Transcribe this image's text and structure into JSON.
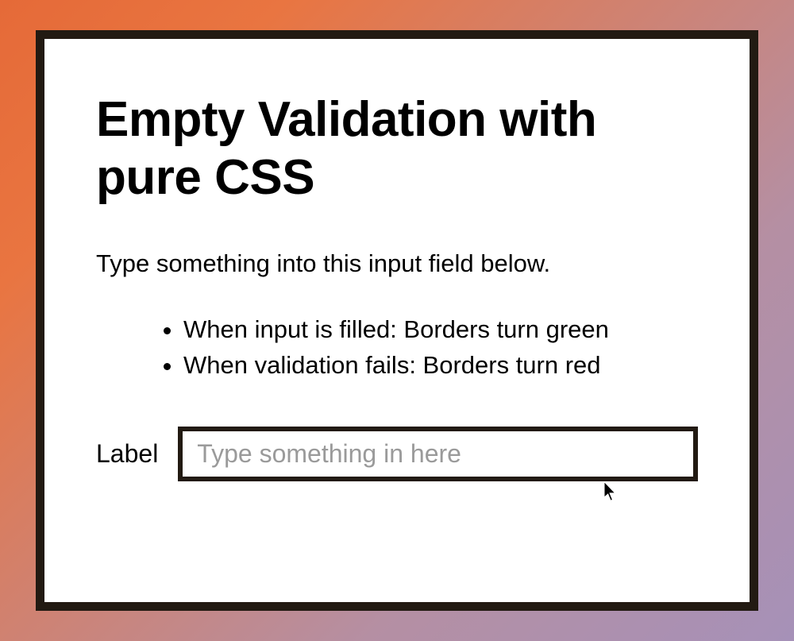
{
  "title": "Empty Validation with pure CSS",
  "intro": "Type something into this input field below.",
  "rules": [
    "When input is filled: Borders turn green",
    "When validation fails: Borders turn red"
  ],
  "form": {
    "label": "Label",
    "value": "",
    "placeholder": "Type something in here"
  },
  "colors": {
    "border": "#221a12",
    "validGreen": "#2ecc71",
    "invalidRed": "#e74c3c"
  }
}
